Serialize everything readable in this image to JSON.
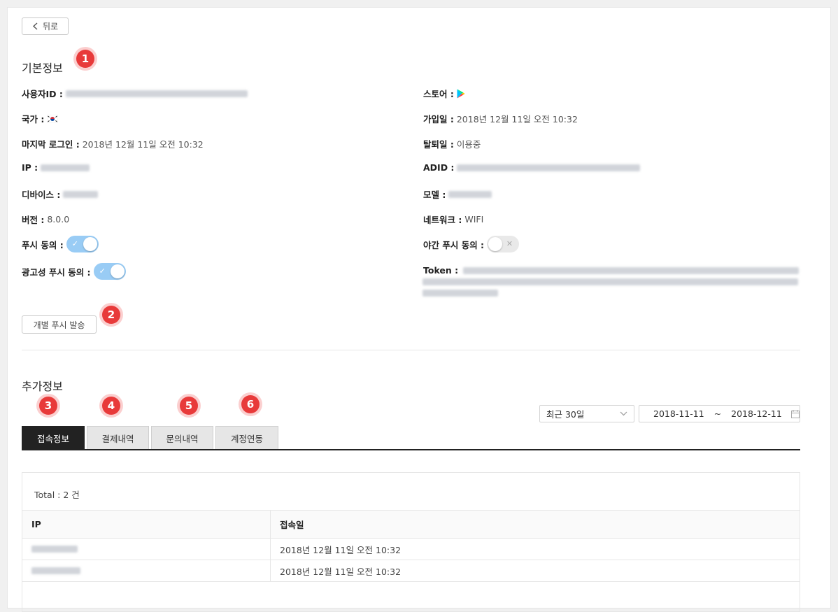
{
  "back_label": "뒤로",
  "basic": {
    "title": "기본정보",
    "badge": "1",
    "left": {
      "user_id": {
        "label": "사용자ID :"
      },
      "country": {
        "label": "국가 :",
        "flag": "korea-flag-icon"
      },
      "last_login": {
        "label": "마지막 로그인 :",
        "value": "2018년 12월 11일 오전 10:32"
      },
      "ip": {
        "label": "IP :"
      },
      "device": {
        "label": "디바이스 :"
      },
      "version": {
        "label": "버전 :",
        "value": "8.0.0"
      },
      "push_agree": {
        "label": "푸시 동의 :",
        "on": true
      },
      "ad_push_agree": {
        "label": "광고성 푸시 동의 :",
        "on": true
      }
    },
    "right": {
      "store": {
        "label": "스토어 :",
        "icon": "google-play-icon"
      },
      "join_date": {
        "label": "가입일 :",
        "value": "2018년 12월 11일 오전 10:32"
      },
      "leave_date": {
        "label": "탈퇴일 :",
        "value": "이용중"
      },
      "adid": {
        "label": "ADID :"
      },
      "model": {
        "label": "모델 :"
      },
      "network": {
        "label": "네트워크 :",
        "value": "WIFI"
      },
      "night_push_agree": {
        "label": "야간 푸시 동의 :",
        "on": false
      },
      "token": {
        "label": "Token :"
      }
    },
    "push_button": "개별 푸시 발송",
    "push_badge": "2"
  },
  "extra": {
    "title": "추가정보",
    "tabs": [
      {
        "label": "접속정보",
        "badge": "3"
      },
      {
        "label": "결제내역",
        "badge": "4"
      },
      {
        "label": "문의내역",
        "badge": "5"
      },
      {
        "label": "계정연동",
        "badge": "6"
      }
    ],
    "period_select": "최근 30일",
    "date_from": "2018-11-11",
    "date_sep": "~",
    "date_to": "2018-12-11",
    "total": "Total : 2 건",
    "table": {
      "headers": [
        "IP",
        "접속일"
      ],
      "rows": [
        {
          "date": "2018년 12월 11일 오전 10:32"
        },
        {
          "date": "2018년 12월 11일 오전 10:32"
        }
      ]
    }
  },
  "colors": {
    "badge": "#e83a3a",
    "toggle_on": "#99ccf5",
    "active_tab": "#222222"
  }
}
